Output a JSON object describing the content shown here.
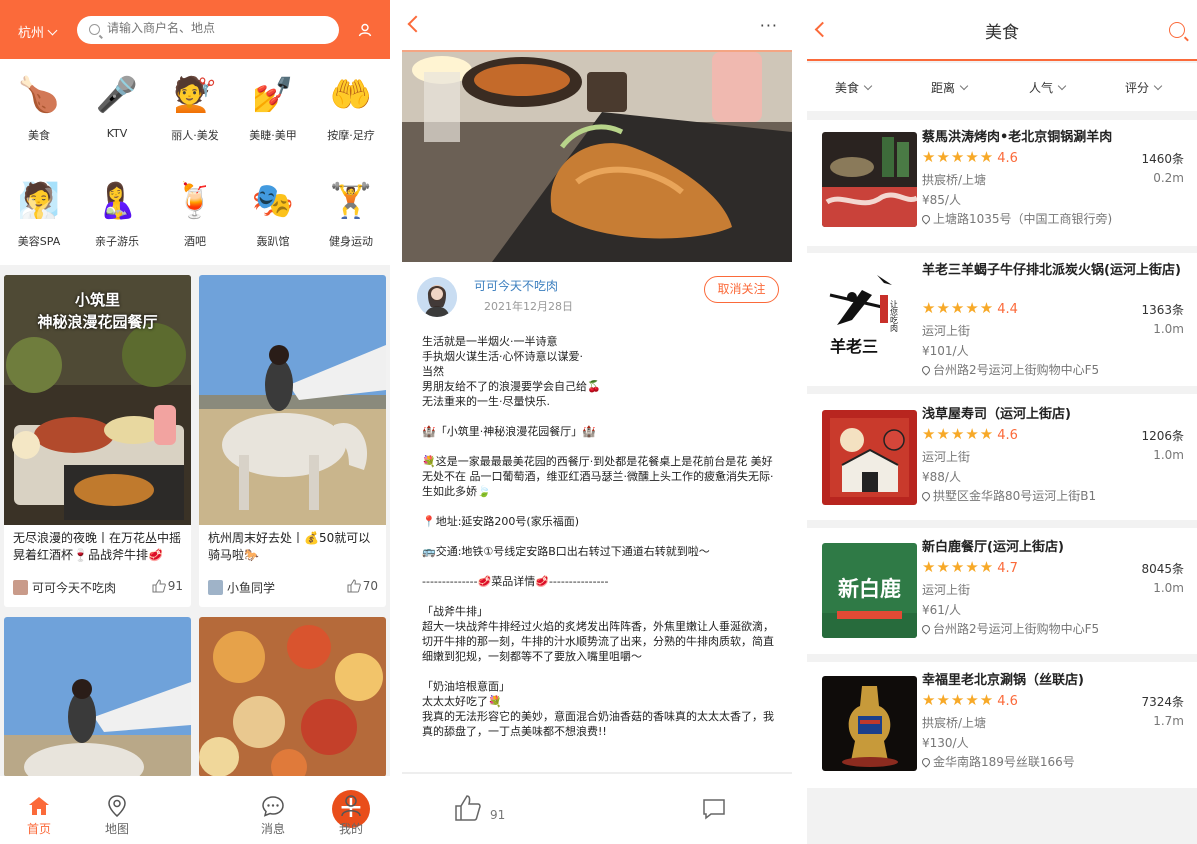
{
  "home": {
    "city": "杭州",
    "search_placeholder": "请输入商户名、地点",
    "categories": [
      {
        "label": "美食",
        "icon": "roast-chicken-icon"
      },
      {
        "label": "KTV",
        "icon": "microphone-icon"
      },
      {
        "label": "丽人·美发",
        "icon": "hair-salon-icon"
      },
      {
        "label": "美睫·美甲",
        "icon": "nail-icon"
      },
      {
        "label": "按摩·足疗",
        "icon": "massage-hand-icon"
      },
      {
        "label": "美容SPA",
        "icon": "face-mask-icon"
      },
      {
        "label": "亲子游乐",
        "icon": "parent-child-icon"
      },
      {
        "label": "酒吧",
        "icon": "cocktail-icon"
      },
      {
        "label": "轰趴馆",
        "icon": "party-mask-icon"
      },
      {
        "label": "健身运动",
        "icon": "dumbbell-icon"
      }
    ],
    "posts": [
      {
        "title": "无尽浪漫的夜晚丨在万花丛中摇晃着红酒杯🍷品战斧牛排🥩",
        "image_text": "小筑里\n神秘浪漫花园餐厅",
        "author": "可可今天不吃肉",
        "likes": "91"
      },
      {
        "title": "杭州周末好去处丨💰50就可以骑马啦🐎",
        "author": "小鱼同学",
        "likes": "70"
      },
      {
        "title": "",
        "author": "",
        "likes": ""
      },
      {
        "title": "",
        "author": "",
        "likes": ""
      }
    ],
    "tabs": [
      {
        "label": "首页",
        "icon": "home-icon"
      },
      {
        "label": "地图",
        "icon": "map-pin-icon"
      },
      {
        "label": "+",
        "icon": "plus-icon"
      },
      {
        "label": "消息",
        "icon": "message-icon"
      },
      {
        "label": "我的",
        "icon": "profile-icon"
      }
    ],
    "accent": "#fb6a3a"
  },
  "detail": {
    "more": "···",
    "author": "可可今天不吃肉",
    "date": "2021年12月28日",
    "unfollow": "取消关注",
    "body": [
      "生活就是一半烟火·一半诗意",
      "手执烟火谋生活·心怀诗意以谋爱·",
      "当然",
      "男朋友给不了的浪漫要学会自己给🍒",
      "无法重来的一生·尽量快乐.",
      "",
      "🏰「小筑里·神秘浪漫花园餐厅」🏰",
      "",
      "💐这是一家最最最美花园的西餐厅·到处都是花餐桌上是花前台是花 美好无处不在 品一口葡萄酒，维亚红酒马瑟兰·微醺上头工作的疲惫消失无际·生如此多娇🍃",
      "",
      "📍地址:延安路200号(家乐福面)",
      "",
      "🚌交通:地铁①号线定安路B口出右转过下通道右转就到啦～",
      "",
      "--------------🥩菜品详情🥩---------------",
      "",
      "「战斧牛排」",
      "超大一块战斧牛排经过火焰的炙烤发出阵阵香，外焦里嫩让人垂涎欲滴，切开牛排的那一刻，牛排的汁水顺势流了出来，分熟的牛排肉质软，简直细嫩到犯规，一刻都等不了要放入嘴里咀嚼～",
      "",
      "「奶油培根意面」",
      "太太太好吃了💐",
      "我真的无法形容它的美妙，意面混合奶油香菇的香味真的太太太香了，我真的舔盘了，一丁点美味都不想浪费!!"
    ],
    "likes": "91"
  },
  "list": {
    "title": "美食",
    "filters": [
      "美食",
      "距离",
      "人气",
      "评分"
    ],
    "shops": [
      {
        "name": "蔡馬洪涛烤肉•老北京铜锅涮羊肉",
        "score": "4.6",
        "stars": "★★★★★",
        "reviews": "1460条",
        "area": "拱宸桥/上塘",
        "distance": "0.2m",
        "price": "¥85/人",
        "address": "上塘路1035号（中国工商银行旁)"
      },
      {
        "name": "羊老三羊蝎子牛仔排北派炭火锅(运河上街店)",
        "score": "4.4",
        "stars": "★★★★★",
        "reviews": "1363条",
        "area": "运河上街",
        "distance": "1.0m",
        "price": "¥101/人",
        "address": "台州路2号运河上街购物中心F5",
        "image_text": "羊老三"
      },
      {
        "name": "浅草屋寿司（运河上街店)",
        "score": "4.6",
        "stars": "★★★★★",
        "reviews": "1206条",
        "area": "运河上街",
        "distance": "1.0m",
        "price": "¥88/人",
        "address": "拱墅区金华路80号运河上街B1"
      },
      {
        "name": "新白鹿餐厅(运河上街店)",
        "score": "4.7",
        "stars": "★★★★★",
        "reviews": "8045条",
        "area": "运河上街",
        "distance": "1.0m",
        "price": "¥61/人",
        "address": "台州路2号运河上街购物中心F5",
        "image_text": "新白鹿"
      },
      {
        "name": "幸福里老北京涮锅（丝联店)",
        "score": "4.6",
        "stars": "★★★★★",
        "reviews": "7324条",
        "area": "拱宸桥/上塘",
        "distance": "1.7m",
        "price": "¥130/人",
        "address": "金华南路189号丝联166号"
      }
    ]
  }
}
